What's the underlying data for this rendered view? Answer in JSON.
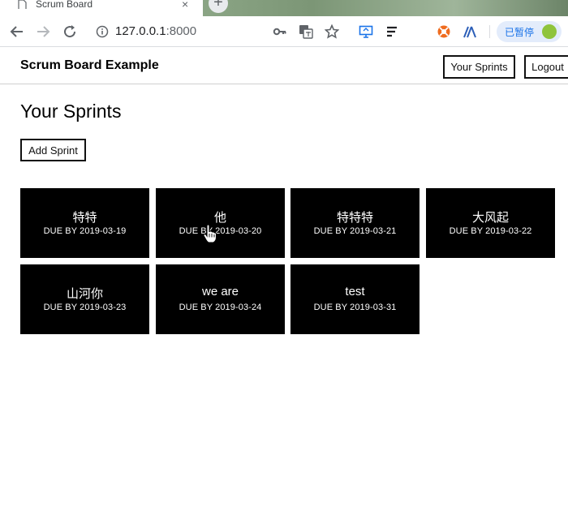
{
  "browser": {
    "tab_title": "Scrum Board",
    "tab_close": "×",
    "new_tab": "+",
    "url_host": "127.0.0.1",
    "url_port": ":8000",
    "paused_label": "已暂停"
  },
  "header": {
    "brand": "Scrum Board Example",
    "your_sprints": "Your Sprints",
    "logout": "Logout"
  },
  "main": {
    "title": "Your Sprints",
    "add_sprint": "Add Sprint",
    "sprints": [
      {
        "name": "特特",
        "due": "DUE BY 2019-03-19"
      },
      {
        "name": "他",
        "due": "DUE BY 2019-03-20"
      },
      {
        "name": "特特特",
        "due": "DUE BY 2019-03-21"
      },
      {
        "name": "大风起",
        "due": "DUE BY 2019-03-22"
      },
      {
        "name": "山河你",
        "due": "DUE BY 2019-03-23"
      },
      {
        "name": "we are",
        "due": "DUE BY 2019-03-24"
      },
      {
        "name": "test",
        "due": "DUE BY 2019-03-31"
      }
    ]
  }
}
